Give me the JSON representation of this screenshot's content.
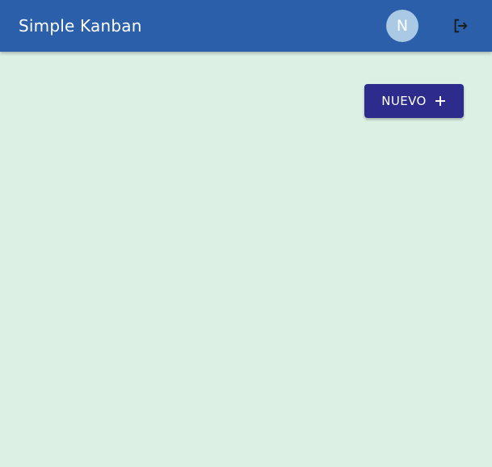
{
  "app_bar": {
    "title": "Simple Kanban",
    "avatar_initial": "N",
    "logout_icon": "logout-icon",
    "background_color": "#2b5faa",
    "avatar_color": "#a9c9e4"
  },
  "main": {
    "background_color": "#dcf0e4",
    "new_button": {
      "label": "NUEVO",
      "icon": "plus-icon",
      "color": "#2d2c8c"
    }
  }
}
